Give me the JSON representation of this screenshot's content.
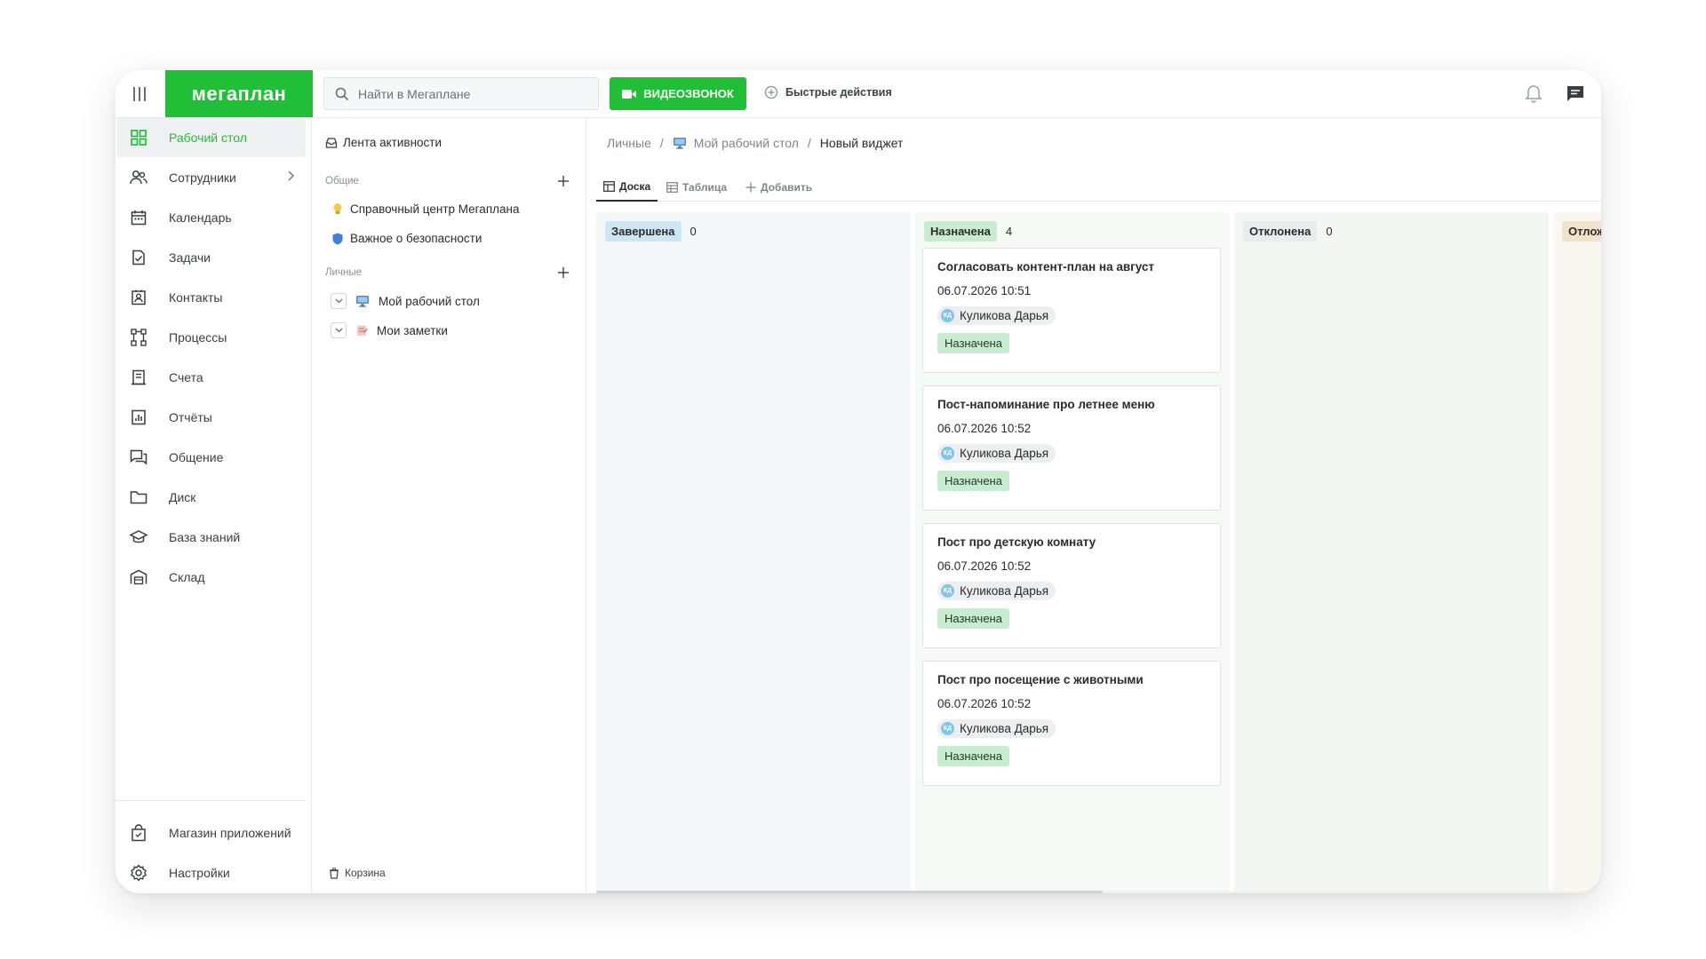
{
  "header": {
    "logo_text": "мегаплан",
    "search_placeholder": "Найти в Мегаплане",
    "video_call_label": "ВИДЕОЗВОНОК",
    "quick_actions_label": "Быстрые действия"
  },
  "sidebar": {
    "items": [
      {
        "label": "Рабочий стол",
        "icon": "dashboard-icon",
        "active": true
      },
      {
        "label": "Сотрудники",
        "icon": "people-icon",
        "has_submenu": true
      },
      {
        "label": "Календарь",
        "icon": "calendar-icon"
      },
      {
        "label": "Задачи",
        "icon": "task-check-icon"
      },
      {
        "label": "Контакты",
        "icon": "contact-card-icon"
      },
      {
        "label": "Процессы",
        "icon": "process-flow-icon"
      },
      {
        "label": "Счета",
        "icon": "invoice-icon"
      },
      {
        "label": "Отчёты",
        "icon": "report-chart-icon"
      },
      {
        "label": "Общение",
        "icon": "chat-bubbles-icon"
      },
      {
        "label": "Диск",
        "icon": "folder-icon"
      },
      {
        "label": "База знаний",
        "icon": "graduation-cap-icon"
      },
      {
        "label": "Склад",
        "icon": "warehouse-icon"
      }
    ],
    "bottom_items": [
      {
        "label": "Магазин приложений",
        "icon": "shopping-bag-icon"
      },
      {
        "label": "Настройки",
        "icon": "gear-icon"
      }
    ]
  },
  "widget_panel": {
    "feed_label": "Лента активности",
    "common_section": "Общие",
    "common_items": [
      {
        "label": "Справочный центр Мегаплана",
        "icon": "lightbulb-icon"
      },
      {
        "label": "Важное о безопасности",
        "icon": "shield-icon"
      }
    ],
    "personal_section": "Личные",
    "personal_items": [
      {
        "label": "Мой рабочий стол",
        "icon": "monitor-icon"
      },
      {
        "label": "Мои заметки",
        "icon": "notes-icon"
      }
    ],
    "trash_label": "Корзина"
  },
  "breadcrumb": {
    "root": "Личные",
    "parent": "Мой рабочий стол",
    "current": "Новый виджет"
  },
  "tabs": [
    {
      "label": "Доска",
      "active": true
    },
    {
      "label": "Таблица",
      "active": false
    },
    {
      "label": "Добавить",
      "active": false
    }
  ],
  "colors": {
    "brand_green": "#21bf37",
    "col_done_bg": "#f4f8f9",
    "col_done_badge": "#cce6f3",
    "col_assigned_bg": "#f5faf4",
    "col_assigned_badge": "#c8ecd0",
    "col_rejected_bg": "#f4f6f3",
    "col_rejected_badge": "#e9ebee",
    "col_postponed_bg": "#faf7f1",
    "col_postponed_badge": "#f3e2cb"
  },
  "board": {
    "columns": [
      {
        "title": "Завершена",
        "count": "0",
        "cards": []
      },
      {
        "title": "Назначена",
        "count": "4",
        "cards": [
          {
            "title": "Согласовать контент-план на август",
            "date": "06.07.2026 10:51",
            "user": "Куликова Дарья",
            "user_initials": "КД",
            "status": "Назначена"
          },
          {
            "title": "Пост-напоминание про летнее меню",
            "date": "06.07.2026 10:52",
            "user": "Куликова Дарья",
            "user_initials": "КД",
            "status": "Назначена"
          },
          {
            "title": "Пост про детскую комнату",
            "date": "06.07.2026 10:52",
            "user": "Куликова Дарья",
            "user_initials": "КД",
            "status": "Назначена"
          },
          {
            "title": "Пост про посещение с животными",
            "date": "06.07.2026 10:52",
            "user": "Куликова Дарья",
            "user_initials": "КД",
            "status": "Назначена"
          }
        ]
      },
      {
        "title": "Отклонена",
        "count": "0",
        "cards": []
      },
      {
        "title": "Отлож",
        "count": "",
        "cards": []
      }
    ]
  }
}
